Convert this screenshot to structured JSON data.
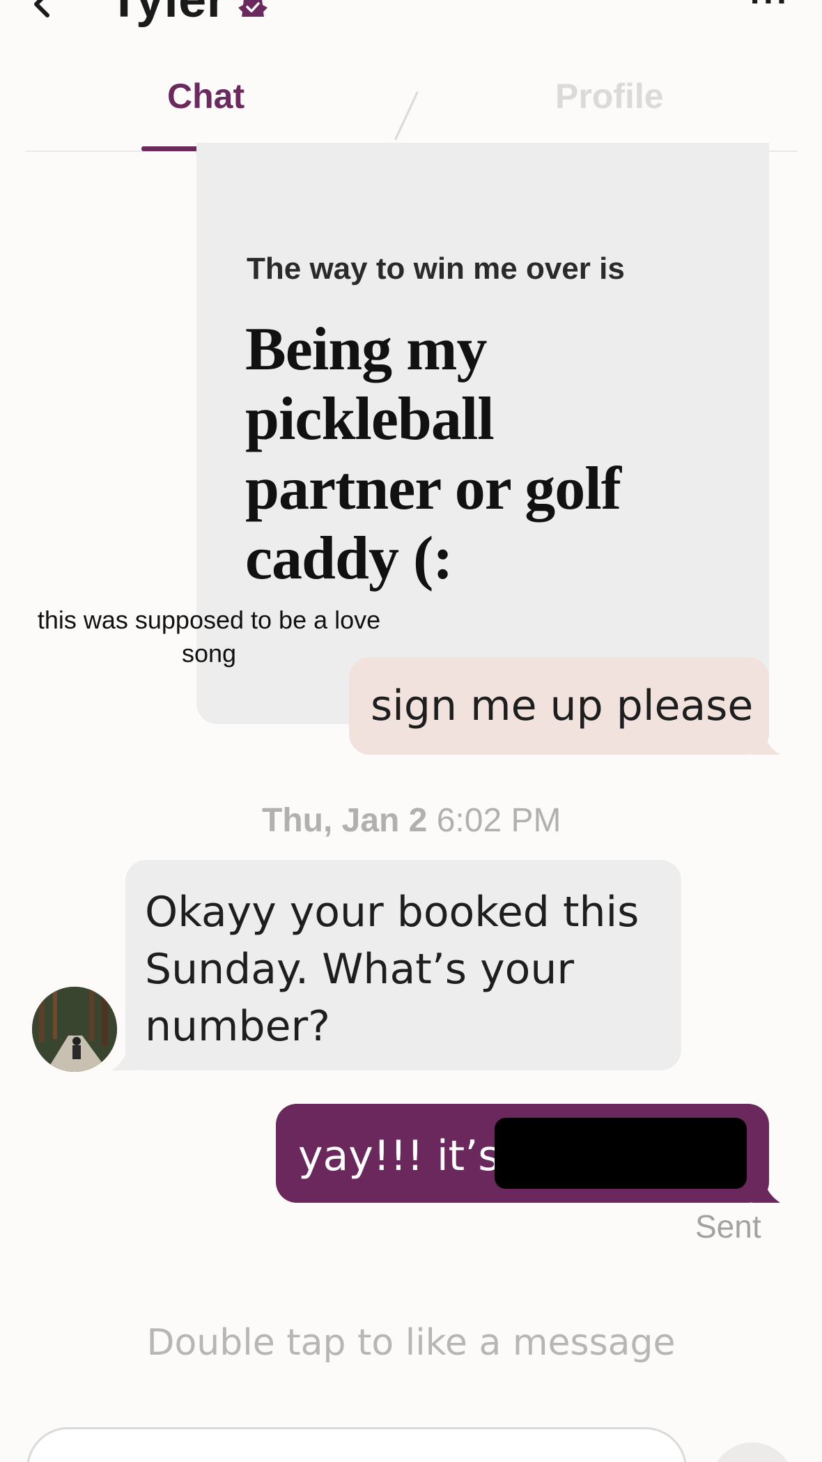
{
  "header": {
    "name": "Tyler",
    "back_icon": "chevron-left-icon",
    "verified_icon": "verified-badge-icon",
    "more_icon": "more-horizontal-icon",
    "more_glyph": "...",
    "accent_color": "#6a2a5e"
  },
  "tabs": [
    {
      "label": "Chat",
      "active": true
    },
    {
      "label": "Profile",
      "active": false
    }
  ],
  "prompt_card": {
    "question": "The way to win me over is",
    "answer": "Being my pickleball partner or golf caddy (:"
  },
  "overlay_caption": "this was supposed to be a love song",
  "messages": {
    "sent_reply": "sign me up please",
    "timestamp_date": "Thu, Jan 2",
    "timestamp_time": "6:02 PM",
    "received": "Okayy your booked this Sunday. What’s your number?",
    "sent_final": "yay!!! it’s",
    "sent_status": "Sent"
  },
  "hint": "Double tap to like a message",
  "composer": {
    "send_icon": "send-icon"
  },
  "colors": {
    "sent_light_bubble": "#f1e2dd",
    "sent_dark_bubble": "#6a285c",
    "received_bubble": "#ededed"
  }
}
